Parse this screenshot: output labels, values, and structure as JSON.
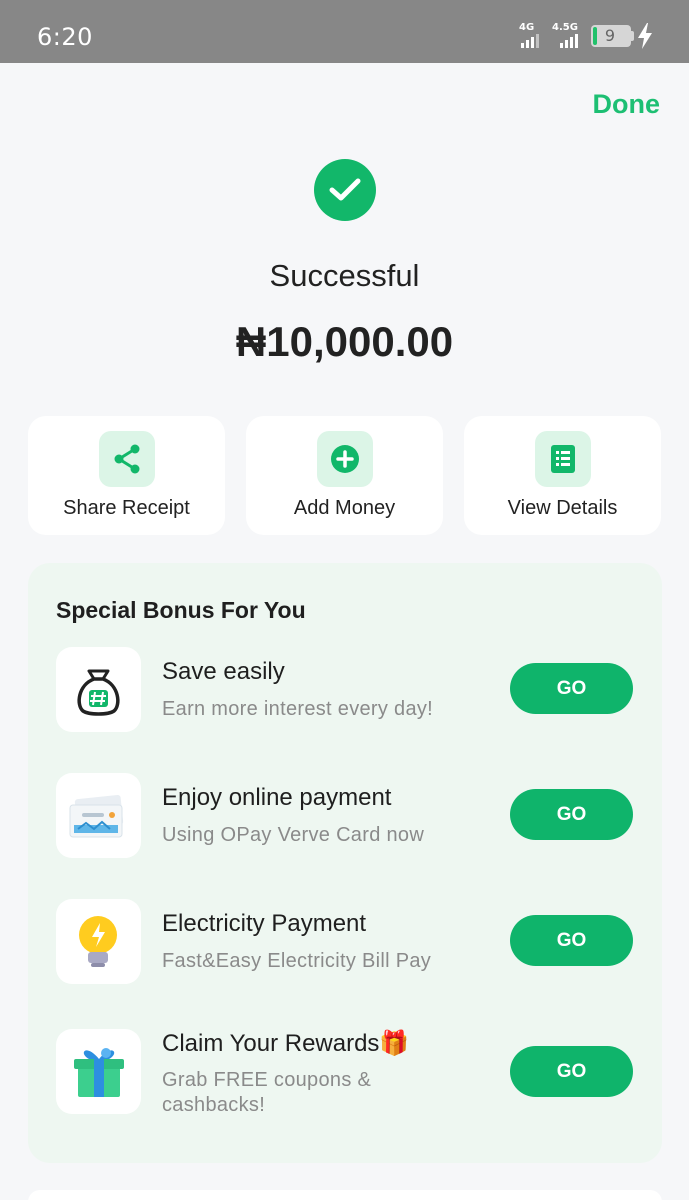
{
  "status_bar": {
    "time": "6:20",
    "network1": "4G",
    "network2": "4.5G",
    "battery_level": "9",
    "charging_icon": "lightning-bolt-icon"
  },
  "header": {
    "done_label": "Done"
  },
  "result": {
    "icon": "check-circle-icon",
    "status": "Successful",
    "amount": "₦10,000.00"
  },
  "actions": [
    {
      "label": "Share Receipt",
      "icon": "share-icon"
    },
    {
      "label": "Add Money",
      "icon": "plus-circle-icon"
    },
    {
      "label": "View Details",
      "icon": "document-list-icon"
    }
  ],
  "bonus": {
    "title": "Special Bonus For You",
    "items": [
      {
        "title": "Save easily",
        "subtitle": "Earn more interest every day!",
        "icon": "money-bag-icon",
        "button": "GO"
      },
      {
        "title": "Enjoy online payment",
        "subtitle": "Using OPay Verve Card now",
        "icon": "payment-card-icon",
        "button": "GO"
      },
      {
        "title": "Electricity Payment",
        "subtitle": "Fast&Easy Electricity Bill Pay",
        "icon": "light-bulb-icon",
        "button": "GO"
      },
      {
        "title": "Claim Your Rewards🎁",
        "subtitle_line1": "Grab FREE coupons &",
        "subtitle_line2": "cashbacks!",
        "icon": "gift-box-icon",
        "button": "GO"
      }
    ]
  },
  "colors": {
    "accent": "#12b76a",
    "accent_light": "#dcf5e7",
    "bonus_bg": "#eef7f1",
    "status_bar": "#878787"
  }
}
